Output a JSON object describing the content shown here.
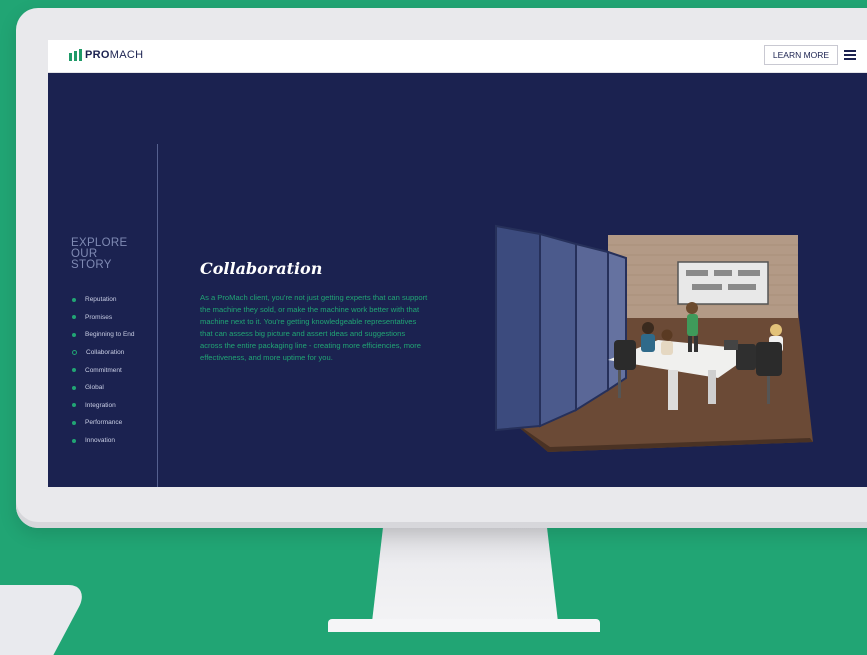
{
  "colors": {
    "background": "#21a574",
    "screen": "#1b2250",
    "accent": "#21a574"
  },
  "header": {
    "logo_bold": "PRO",
    "logo_light": "MACH",
    "learn_more_label": "LEARN MORE",
    "menu_icon": "hamburger-menu-icon"
  },
  "sidebar": {
    "explore_line1": "EXPLORE",
    "explore_line2": "OUR",
    "explore_line3": "STORY",
    "active_item": "Collaboration",
    "items": [
      {
        "label": "Reputation"
      },
      {
        "label": "Promises"
      },
      {
        "label": "Beginning to End"
      },
      {
        "label": "Collaboration"
      },
      {
        "label": "Commitment"
      },
      {
        "label": "Global"
      },
      {
        "label": "Integration"
      },
      {
        "label": "Performance"
      },
      {
        "label": "Innovation"
      }
    ]
  },
  "main": {
    "title": "Collaboration",
    "body": "As a ProMach client, you're not just getting experts that can support the machine they sold, or make the machine work better with that machine next to it. You're getting knowledgeable representatives that can assess big picture and assert ideas and suggestions across the entire packaging line - creating more efficiencies, more effectiveness, and more uptime for you."
  }
}
